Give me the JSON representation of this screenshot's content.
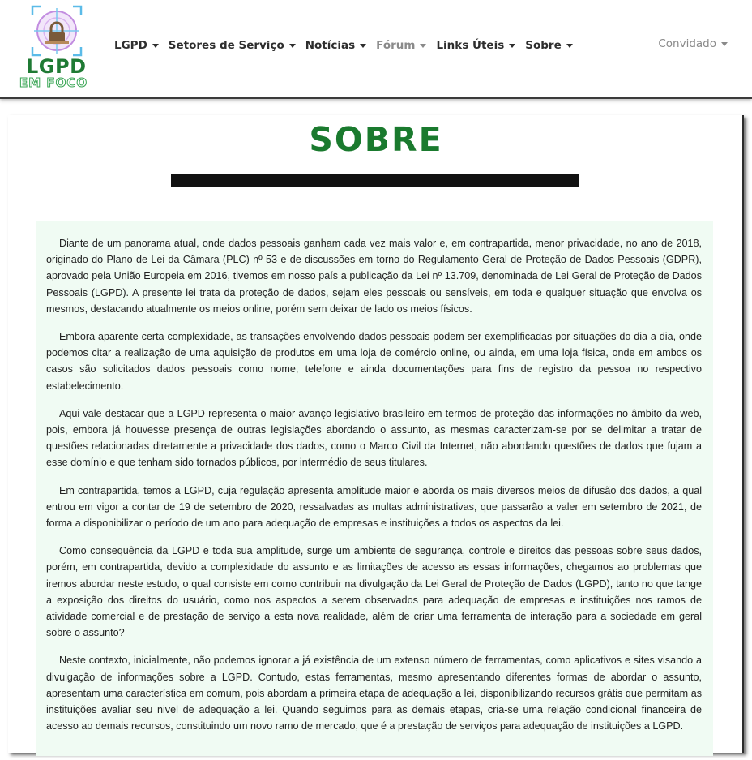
{
  "brand": {
    "line1": "LGPD",
    "line2": "EM FOCO"
  },
  "nav": {
    "items": [
      {
        "label": "LGPD"
      },
      {
        "label": "Setores de Serviço"
      },
      {
        "label": "Notícias"
      },
      {
        "label": "Fórum"
      },
      {
        "label": "Links Úteis"
      },
      {
        "label": "Sobre"
      }
    ],
    "user": "Convidado"
  },
  "colors": {
    "accent": "#1a7a2e",
    "panel": "#f0fbf3"
  },
  "page": {
    "title": "SOBRE",
    "paragraphs": [
      "Diante de um panorama atual, onde dados pessoais ganham cada vez mais valor e, em contrapartida, menor privacidade, no ano de 2018, originado do Plano de Lei da Câmara (PLC) nº 53 e de discussões em torno do Regulamento Geral de Proteção de Dados Pessoais (GDPR), aprovado pela União Europeia em 2016, tivemos em nosso país a publicação da Lei nº 13.709, denominada de Lei Geral de Proteção de Dados Pessoais (LGPD). A presente lei trata da proteção de dados, sejam eles pessoais ou sensíveis, em toda e qualquer situação que envolva os mesmos, destacando atualmente os meios online, porém sem deixar de lado os meios físicos.",
      "Embora aparente certa complexidade, as transações envolvendo dados pessoais podem ser exemplificadas por situações do dia a dia, onde podemos citar a realização de uma aquisição de produtos em uma loja de comércio online, ou ainda, em uma loja física, onde em ambos os casos são solicitados dados pessoais como nome, telefone e ainda documentações para fins de registro da pessoa no respectivo estabelecimento.",
      "Aqui vale destacar que a LGPD representa o maior avanço legislativo brasileiro em termos de proteção das informações no âmbito da web, pois, embora já houvesse presença de outras legislações abordando o assunto, as mesmas caracterizam-se por se delimitar a tratar de questões relacionadas diretamente a privacidade dos dados, como o Marco Civil da Internet, não abordando questões de dados que fujam a esse domínio e que tenham sido tornados públicos, por intermédio de seus titulares.",
      "Em contrapartida, temos a LGPD, cuja regulação apresenta amplitude maior e aborda os mais diversos meios de difusão dos dados, a qual entrou em vigor a contar de 19 de setembro de 2020, ressalvadas as multas administrativas, que passarão a valer em setembro de 2021, de forma a disponibilizar o período de um ano para adequação de empresas e instituições a todos os aspectos da lei.",
      "Como consequência da LGPD e toda sua amplitude, surge um ambiente de segurança, controle e direitos das pessoas sobre seus dados, porém, em contrapartida, devido a complexidade do assunto e as limitações de acesso as essas informações, chegamos ao problemas que iremos abordar neste estudo, o qual consiste em como contribuir na divulgação da Lei Geral de Proteção de Dados (LGPD), tanto no que tange a exposição dos direitos do usuário, como nos aspectos a serem observados para adequação de empresas e instituições nos ramos de atividade comercial e de prestação de serviço a esta nova realidade, além de criar uma ferramenta de interação para a sociedade em geral sobre o assunto?",
      "Neste contexto, inicialmente, não podemos ignorar a já existência de um extenso número de ferramentas, como aplicativos e sites visando a divulgação de informações sobre a LGPD. Contudo, estas ferramentas, mesmo apresentando diferentes formas de abordar o assunto, apresentam uma característica em comum, pois abordam a primeira etapa de adequação a lei, disponibilizando recursos grátis que permitam as instituições avaliar seu nivel de adequação a lei. Quando seguimos para as demais etapas, cria-se uma relação condicional financeira de acesso ao demais recursos, constituindo um novo ramo de mercado, que é a prestação de serviços para adequação de instituições a LGPD."
    ]
  }
}
